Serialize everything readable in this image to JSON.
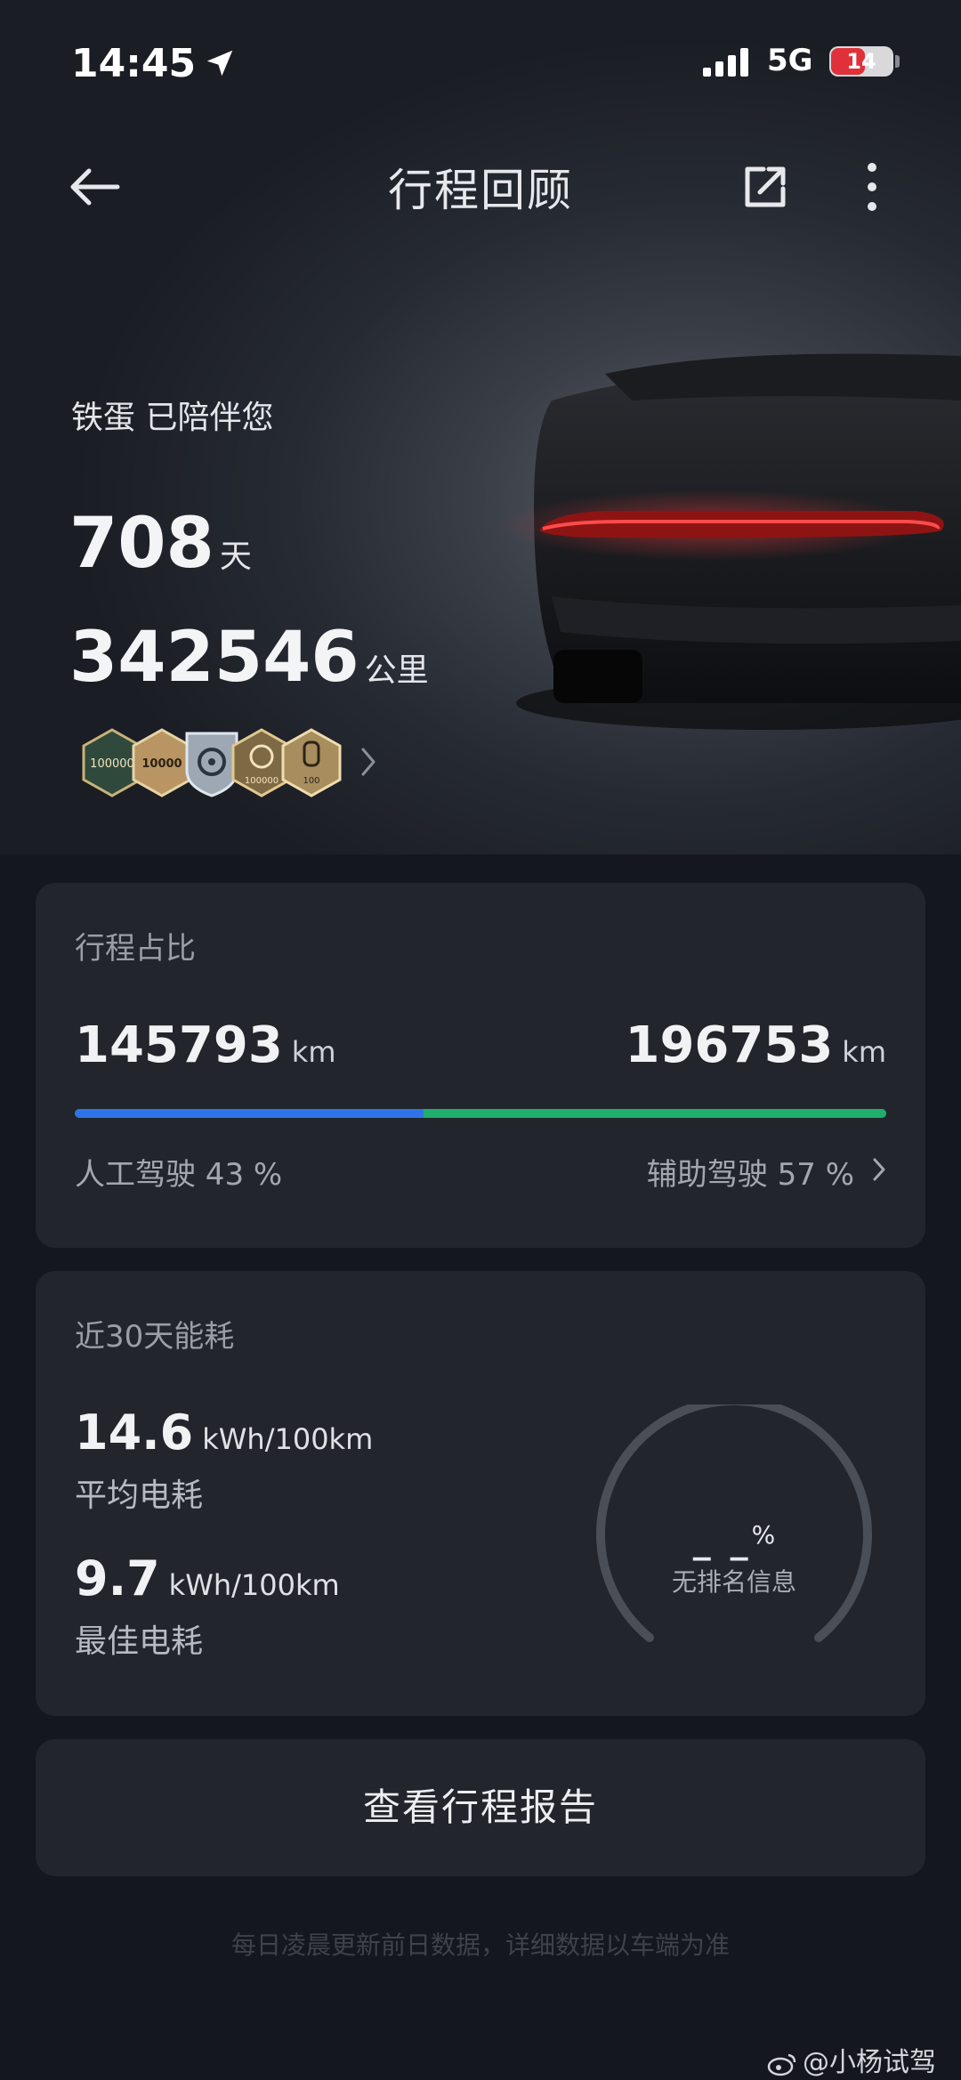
{
  "status_bar": {
    "time": "14:45",
    "network": "5G",
    "battery": "14",
    "battery_fraction": 0.14
  },
  "header": {
    "title": "行程回顾"
  },
  "summary": {
    "companion_text": "铁蛋 已陪伴您",
    "days_value": "708",
    "days_unit": "天",
    "distance_value": "342546",
    "distance_unit": "公里",
    "badges": [
      "100000",
      "10000",
      "100000",
      "100"
    ]
  },
  "trip_ratio": {
    "title": "行程占比",
    "manual_km": "145793",
    "assisted_km": "196753",
    "unit": "km",
    "manual_label": "人工驾驶 43 %",
    "assisted_label": "辅助驾驶 57 %",
    "manual_fraction": 0.43,
    "colors": {
      "manual": "#2f74e6",
      "assisted": "#1fae6d"
    }
  },
  "energy": {
    "title": "近30天能耗",
    "avg_value": "14.6",
    "avg_unit": "kWh/100km",
    "avg_label": "平均电耗",
    "best_value": "9.7",
    "best_unit": "kWh/100km",
    "best_label": "最佳电耗",
    "rank_value": "_ _",
    "rank_unit": "%",
    "rank_label": "无排名信息"
  },
  "report_button": {
    "label": "查看行程报告"
  },
  "footer": {
    "note": "每日凌晨更新前日数据，详细数据以车端为准"
  },
  "watermark": {
    "text": "@小杨试驾"
  }
}
